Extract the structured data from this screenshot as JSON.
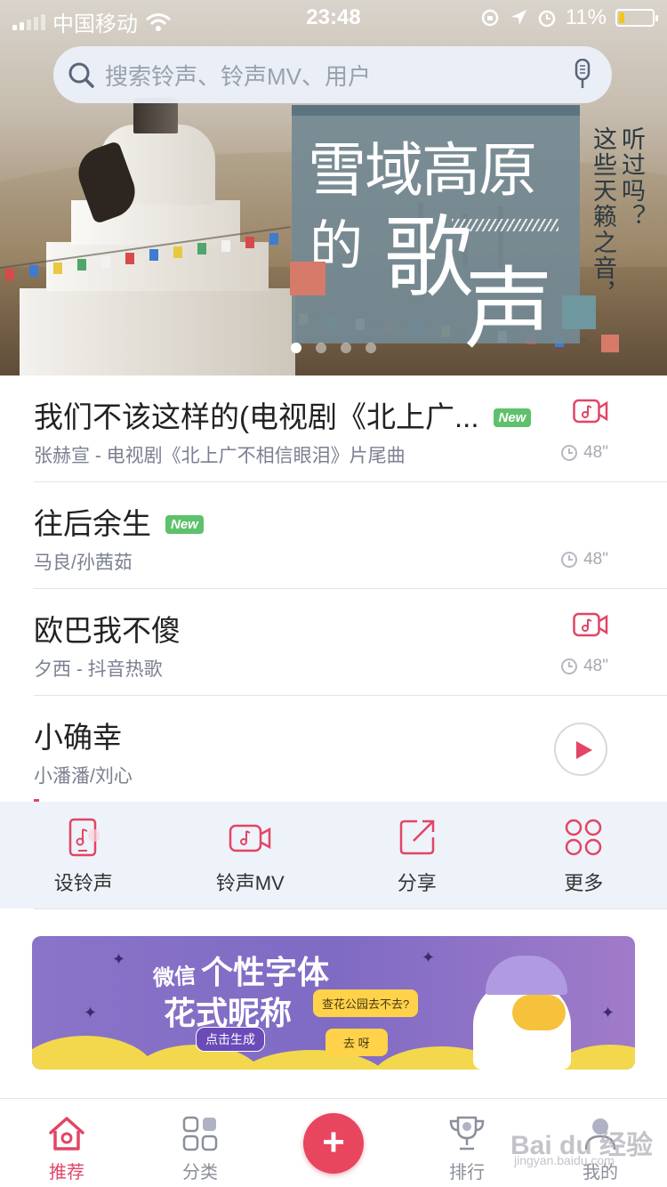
{
  "status_bar": {
    "carrier": "中国移动",
    "time": "23:48",
    "battery": "11%"
  },
  "search": {
    "placeholder": "搜索铃声、铃声MV、用户"
  },
  "banner": {
    "title_line1": "雪域高原",
    "title_de": "的",
    "title_ge": "歌",
    "title_sheng": "声",
    "side_col1": "听过吗？",
    "side_col2": "这些天籁之音，",
    "colors": {
      "card": "#748a93",
      "accent_red": "#d67a6a",
      "accent_teal": "#6f97a0"
    },
    "page_count": 4,
    "active_page": 1
  },
  "songs": [
    {
      "title": "我们不该这样的(电视剧《北上广...",
      "subtitle": "张赫宣 - 电视剧《北上广不相信眼泪》片尾曲",
      "is_new": true,
      "new_label": "New",
      "has_mv": true,
      "duration": "48\""
    },
    {
      "title": "往后余生",
      "subtitle": "马良/孙茜茹",
      "is_new": true,
      "new_label": "New",
      "has_mv": false,
      "duration": "48\""
    },
    {
      "title": "欧巴我不傻",
      "subtitle": "夕西 - 抖音热歌",
      "is_new": false,
      "has_mv": true,
      "duration": "48\""
    },
    {
      "title": "小确幸",
      "subtitle": "小潘潘/刘心",
      "is_new": false,
      "has_mv": false,
      "playing": true
    }
  ],
  "actions": [
    {
      "label": "设铃声",
      "icon": "phone-ringtone-icon"
    },
    {
      "label": "铃声MV",
      "icon": "video-camera-icon"
    },
    {
      "label": "分享",
      "icon": "share-icon"
    },
    {
      "label": "更多",
      "icon": "more-grid-icon"
    }
  ],
  "ad": {
    "wechat": "微信",
    "line1": "个性字体",
    "line2": "花式昵称",
    "button": "点击生成",
    "bubble1": "查花公园去不去?",
    "bubble2": "去  呀"
  },
  "tabs": [
    {
      "label": "推荐",
      "icon": "home-icon",
      "active": true
    },
    {
      "label": "分类",
      "icon": "category-grid-icon",
      "active": false
    },
    {
      "label": "",
      "icon": "plus-icon",
      "active": false
    },
    {
      "label": "排行",
      "icon": "trophy-icon",
      "active": false
    },
    {
      "label": "我的",
      "icon": "profile-icon",
      "active": false
    }
  ],
  "watermark": {
    "main": "Bai du 经验",
    "sub": "jingyan.baidu.com"
  },
  "colors": {
    "accent": "#e24565",
    "new_badge": "#5ec16b",
    "action_bg": "#eef3fa"
  }
}
